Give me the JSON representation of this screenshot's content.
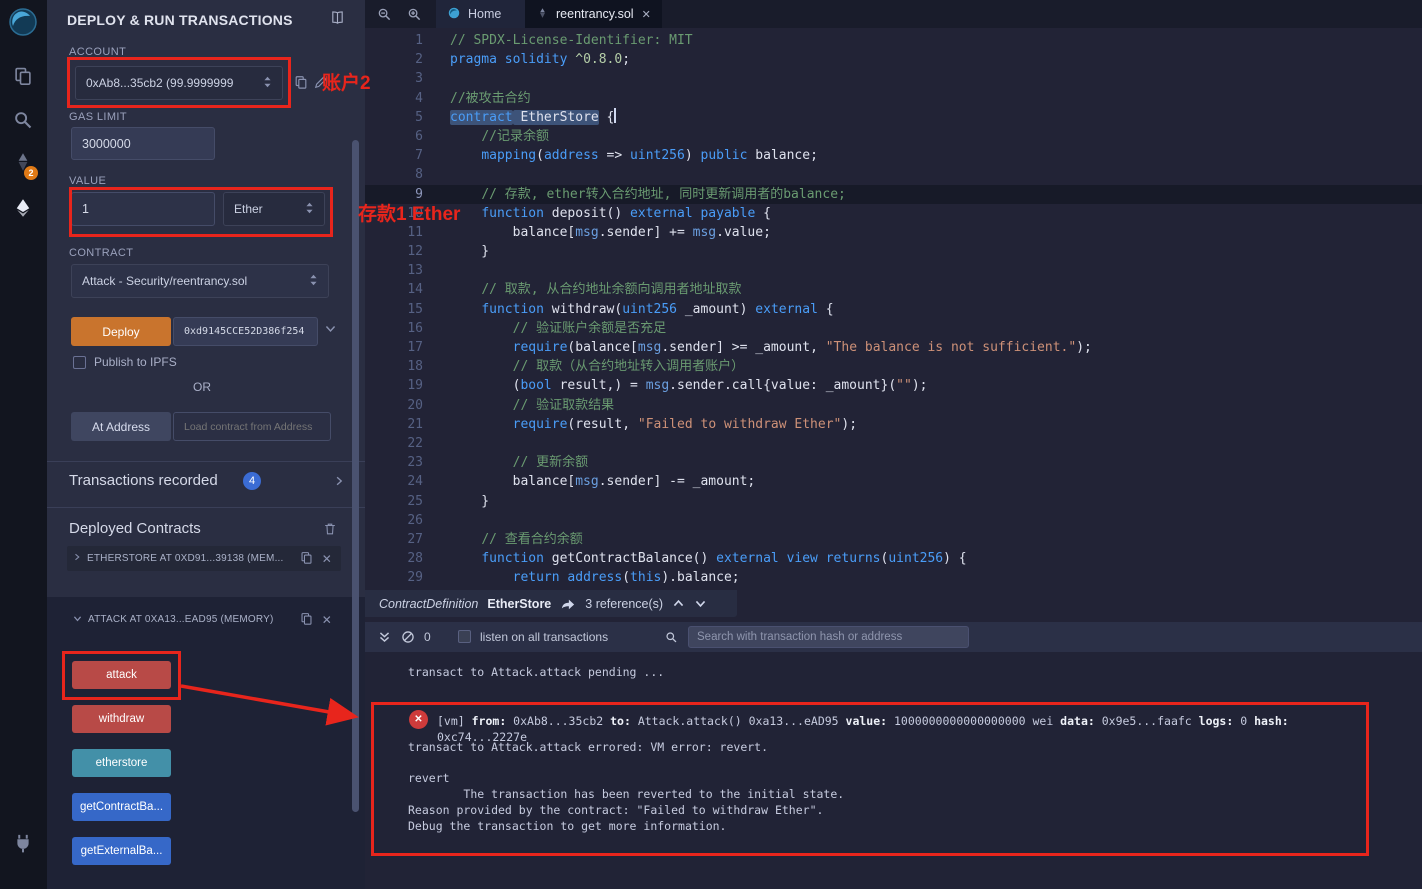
{
  "colors": {
    "annotation": "#e8251c",
    "deploy_button": "#c9742d",
    "danger_button": "#b84a47",
    "info_button": "#4390a8",
    "primary_button": "#3668c8",
    "badge_blue": "#3b6cd4",
    "badge_orange": "#e07a16"
  },
  "rail": {
    "compiler_badge": "2"
  },
  "panel": {
    "title": "DEPLOY & RUN TRANSACTIONS",
    "account_label": "ACCOUNT",
    "account_value": "0xAb8...35cb2 (99.9999999",
    "gas_label": "GAS LIMIT",
    "gas_value": "3000000",
    "value_label": "VALUE",
    "value_amount": "1",
    "value_unit": "Ether",
    "contract_label": "CONTRACT",
    "contract_value": "Attack - Security/reentrancy.sol",
    "deploy_label": "Deploy",
    "deploy_address": "0xd9145CCE52D386f254",
    "publish_label": "Publish to IPFS",
    "or_label": "OR",
    "at_address_label": "At Address",
    "at_address_placeholder": "Load contract from Address",
    "transactions_label": "Transactions recorded",
    "transactions_count": "4",
    "deployed_title": "Deployed Contracts",
    "etherstore_item": "ETHERSTORE AT 0XD91...39138 (MEM...",
    "attack_item": "ATTACK AT 0XA13...EAD95 (MEMORY)",
    "contract_buttons": [
      {
        "label": "attack",
        "kind": "danger"
      },
      {
        "label": "withdraw",
        "kind": "danger"
      },
      {
        "label": "etherstore",
        "kind": "info"
      },
      {
        "label": "getContractBa...",
        "kind": "primary"
      },
      {
        "label": "getExternalBa...",
        "kind": "primary"
      }
    ]
  },
  "annotations": {
    "account_note": "账户2",
    "value_note": "存款1 Ether"
  },
  "tabs": [
    {
      "label": "Home"
    },
    {
      "label": "reentrancy.sol"
    }
  ],
  "editor": {
    "current_line": 9,
    "lines": [
      [
        [
          "c",
          "// SPDX-License-Identifier: MIT"
        ]
      ],
      [
        [
          "k",
          "pragma"
        ],
        [
          "p",
          " "
        ],
        [
          "k",
          "solidity"
        ],
        [
          "p",
          " "
        ],
        [
          "n",
          "^0.8.0"
        ],
        [
          "p",
          ";"
        ]
      ],
      [],
      [
        [
          "c",
          "//被攻击合约"
        ]
      ],
      [
        [
          "ksel",
          "contract"
        ],
        [
          "psel",
          " EtherStore"
        ],
        [
          "p",
          " {"
        ],
        [
          "caret",
          ""
        ]
      ],
      [
        [
          "p",
          "    "
        ],
        [
          "c",
          "//记录余额"
        ]
      ],
      [
        [
          "p",
          "    "
        ],
        [
          "k",
          "mapping"
        ],
        [
          "p",
          "("
        ],
        [
          "k",
          "address"
        ],
        [
          "p",
          " => "
        ],
        [
          "k",
          "uint256"
        ],
        [
          "p",
          ") "
        ],
        [
          "k",
          "public"
        ],
        [
          "p",
          " balance;"
        ]
      ],
      [],
      [
        [
          "p",
          "    "
        ],
        [
          "c",
          "// 存款, ether转入合约地址, 同时更新调用者的balance;"
        ]
      ],
      [
        [
          "p",
          "    "
        ],
        [
          "k",
          "function"
        ],
        [
          "p",
          " deposit() "
        ],
        [
          "k",
          "external"
        ],
        [
          "p",
          " "
        ],
        [
          "k",
          "payable"
        ],
        [
          "p",
          " {"
        ]
      ],
      [
        [
          "p",
          "        balance["
        ],
        [
          "m",
          "msg"
        ],
        [
          "p",
          ".sender] += "
        ],
        [
          "m",
          "msg"
        ],
        [
          "p",
          ".value;"
        ]
      ],
      [
        [
          "p",
          "    }"
        ]
      ],
      [],
      [
        [
          "p",
          "    "
        ],
        [
          "c",
          "// 取款, 从合约地址余额向调用者地址取款"
        ]
      ],
      [
        [
          "p",
          "    "
        ],
        [
          "k",
          "function"
        ],
        [
          "p",
          " withdraw("
        ],
        [
          "k",
          "uint256"
        ],
        [
          "p",
          " _amount) "
        ],
        [
          "k",
          "external"
        ],
        [
          "p",
          " {"
        ]
      ],
      [
        [
          "p",
          "        "
        ],
        [
          "c",
          "// 验证账户余额是否充足"
        ]
      ],
      [
        [
          "p",
          "        "
        ],
        [
          "k",
          "require"
        ],
        [
          "p",
          "(balance["
        ],
        [
          "m",
          "msg"
        ],
        [
          "p",
          ".sender] >= _amount, "
        ],
        [
          "s",
          "\"The balance is not sufficient.\""
        ],
        [
          "p",
          ");"
        ]
      ],
      [
        [
          "p",
          "        "
        ],
        [
          "c",
          "// 取款（从合约地址转入调用者账户）"
        ]
      ],
      [
        [
          "p",
          "        ("
        ],
        [
          "k",
          "bool"
        ],
        [
          "p",
          " result,) = "
        ],
        [
          "m",
          "msg"
        ],
        [
          "p",
          ".sender.call{value: _amount}("
        ],
        [
          "s",
          "\"\""
        ],
        [
          "p",
          ");"
        ]
      ],
      [
        [
          "p",
          "        "
        ],
        [
          "c",
          "// 验证取款结果"
        ]
      ],
      [
        [
          "p",
          "        "
        ],
        [
          "k",
          "require"
        ],
        [
          "p",
          "(result, "
        ],
        [
          "s",
          "\"Failed to withdraw Ether\""
        ],
        [
          "p",
          ");"
        ]
      ],
      [],
      [
        [
          "p",
          "        "
        ],
        [
          "c",
          "// 更新余额"
        ]
      ],
      [
        [
          "p",
          "        balance["
        ],
        [
          "m",
          "msg"
        ],
        [
          "p",
          ".sender] -= _amount;"
        ]
      ],
      [
        [
          "p",
          "    }"
        ]
      ],
      [],
      [
        [
          "p",
          "    "
        ],
        [
          "c",
          "// 查看合约余额"
        ]
      ],
      [
        [
          "p",
          "    "
        ],
        [
          "k",
          "function"
        ],
        [
          "p",
          " getContractBalance() "
        ],
        [
          "k",
          "external"
        ],
        [
          "p",
          " "
        ],
        [
          "k",
          "view"
        ],
        [
          "p",
          " "
        ],
        [
          "k",
          "returns"
        ],
        [
          "p",
          "("
        ],
        [
          "k",
          "uint256"
        ],
        [
          "p",
          ") {"
        ]
      ],
      [
        [
          "p",
          "        "
        ],
        [
          "k",
          "return"
        ],
        [
          "p",
          " "
        ],
        [
          "k",
          "address"
        ],
        [
          "p",
          "("
        ],
        [
          "k",
          "this"
        ],
        [
          "p",
          ").balance;"
        ]
      ],
      [
        [
          "p",
          "    }"
        ]
      ]
    ]
  },
  "context_bar": {
    "node_type": "ContractDefinition",
    "symbol": "EtherStore",
    "references": "3 reference(s)"
  },
  "terminal": {
    "count": "0",
    "listen_label": "listen on all transactions",
    "search_placeholder": "Search with transaction hash or address",
    "pending_line": "transact to Attack.attack pending ...",
    "error": {
      "summary": [
        [
          "p",
          "[vm] "
        ],
        [
          "b",
          "from:"
        ],
        [
          "p",
          " 0xAb8...35cb2 "
        ],
        [
          "b",
          "to:"
        ],
        [
          "p",
          " Attack.attack() 0xa13...eAD95 "
        ],
        [
          "b",
          "value:"
        ],
        [
          "p",
          " 1000000000000000000 wei "
        ],
        [
          "b",
          "data:"
        ],
        [
          "p",
          " 0x9e5...faafc "
        ],
        [
          "b",
          "logs:"
        ],
        [
          "p",
          " 0 "
        ],
        [
          "b",
          "hash:"
        ],
        [
          "p",
          " 0xc74...2227e"
        ]
      ],
      "errored_line": "transact to Attack.attack errored: VM error: revert.",
      "detail_lines": [
        "revert",
        "\tThe transaction has been reverted to the initial state.",
        "Reason provided by the contract: \"Failed to withdraw Ether\".",
        "Debug the transaction to get more information."
      ]
    }
  }
}
